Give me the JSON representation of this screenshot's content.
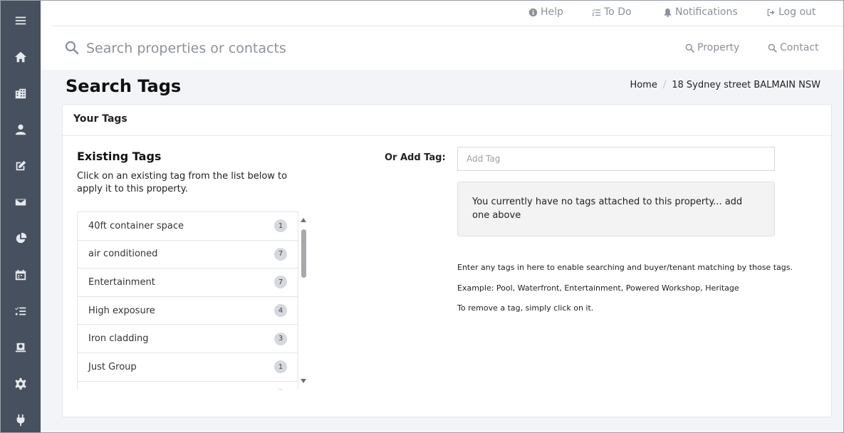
{
  "sidebar": {
    "icons": [
      "menu-icon",
      "home-icon",
      "building-icon",
      "user-icon",
      "edit-icon",
      "mail-icon",
      "pie-chart-icon",
      "calendar-icon",
      "tasks-icon",
      "money-icon",
      "gear-icon",
      "plug-icon"
    ]
  },
  "topnav": {
    "help": "Help",
    "todo": "To Do",
    "notifications": "Notifications",
    "logout": "Log out"
  },
  "search": {
    "placeholder": "Search properties or contacts",
    "property": "Property",
    "contact": "Contact"
  },
  "page": {
    "title": "Search Tags",
    "breadcrumb": [
      "Home",
      "18 Sydney street BALMAIN NSW"
    ]
  },
  "card": {
    "header": "Your Tags",
    "existing_title": "Existing Tags",
    "existing_desc": "Click on an existing tag from the list below to apply it to this property.",
    "tags": [
      {
        "name": "40ft container space",
        "count": "1"
      },
      {
        "name": "air conditioned",
        "count": "7"
      },
      {
        "name": "Entertainment",
        "count": "7"
      },
      {
        "name": "High exposure",
        "count": "4"
      },
      {
        "name": "Iron cladding",
        "count": "3"
      },
      {
        "name": "Just Group",
        "count": "1"
      },
      {
        "name": "",
        "count": ""
      }
    ],
    "add_label": "Or Add Tag:",
    "add_placeholder": "Add Tag",
    "no_tags_message": "You currently have no tags attached to this property... add one above",
    "help_lines": [
      "Enter any tags in here to enable searching and buyer/tenant matching by those tags.",
      "Example: Pool, Waterfront, Entertainment, Powered Workshop, Heritage",
      "To remove a tag, simply click on it."
    ]
  },
  "colors": {
    "sidebar": "#46505e",
    "content_bg": "#f3f4f7",
    "muted_text": "#8a9199"
  }
}
